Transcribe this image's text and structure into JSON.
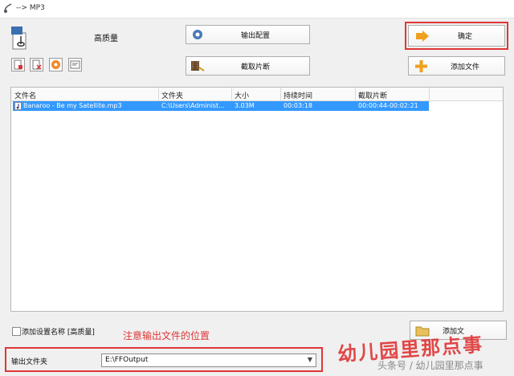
{
  "window": {
    "title": "--> MP3"
  },
  "toolbar": {
    "quality_label": "高质量",
    "output_config_label": "输出配置",
    "clip_label": "截取片断",
    "ok_label": "确定",
    "add_file_label": "添加文件"
  },
  "list": {
    "columns": [
      "文件名",
      "文件夹",
      "大小",
      "持续时间",
      "截取片断"
    ],
    "rows": [
      {
        "name": "Banaroo - Be my Satellite.mp3",
        "folder": "C:\\Users\\Administ...",
        "size": "3.03M",
        "duration": "00:03:18",
        "clip": "00:00:44-00:02:21"
      }
    ]
  },
  "bottom": {
    "save_setting_label": "添加设置名称 [高质量]",
    "note": "注意输出文件的位置",
    "add_folder_label": "添加文",
    "output_folder_label": "输出文件夹",
    "output_folder_value": "E:\\FFOutput"
  },
  "watermark": {
    "main": "幼儿园里那点事",
    "sub": "头条号 / 幼儿园里那点事"
  },
  "colors": {
    "highlight": "#e03535",
    "selection": "#3399ff",
    "arrow": "#f0a020"
  }
}
